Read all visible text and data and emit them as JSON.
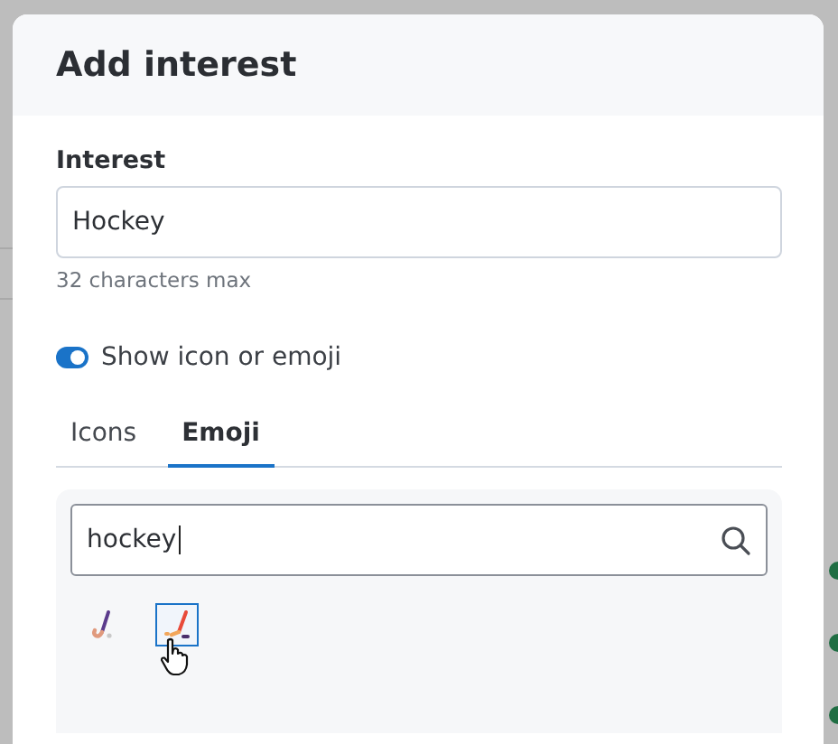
{
  "dialog": {
    "title": "Add interest",
    "interest_field": {
      "label": "Interest",
      "value": "Hockey",
      "hint": "32 characters max"
    },
    "toggle": {
      "label": "Show icon or emoji",
      "on": true
    },
    "tabs": [
      {
        "label": "Icons",
        "selected": false
      },
      {
        "label": "Emoji",
        "selected": true
      }
    ],
    "emoji_search": {
      "value": "hockey"
    },
    "emoji_results": [
      {
        "kind": "field-hockey",
        "selected": false
      },
      {
        "kind": "ice-hockey",
        "selected": true
      }
    ]
  },
  "backdrop": {
    "status_dots": [
      {
        "color": "#1f6e43"
      },
      {
        "color": "#1f6e43"
      },
      {
        "color": "#1f6e43"
      }
    ]
  }
}
